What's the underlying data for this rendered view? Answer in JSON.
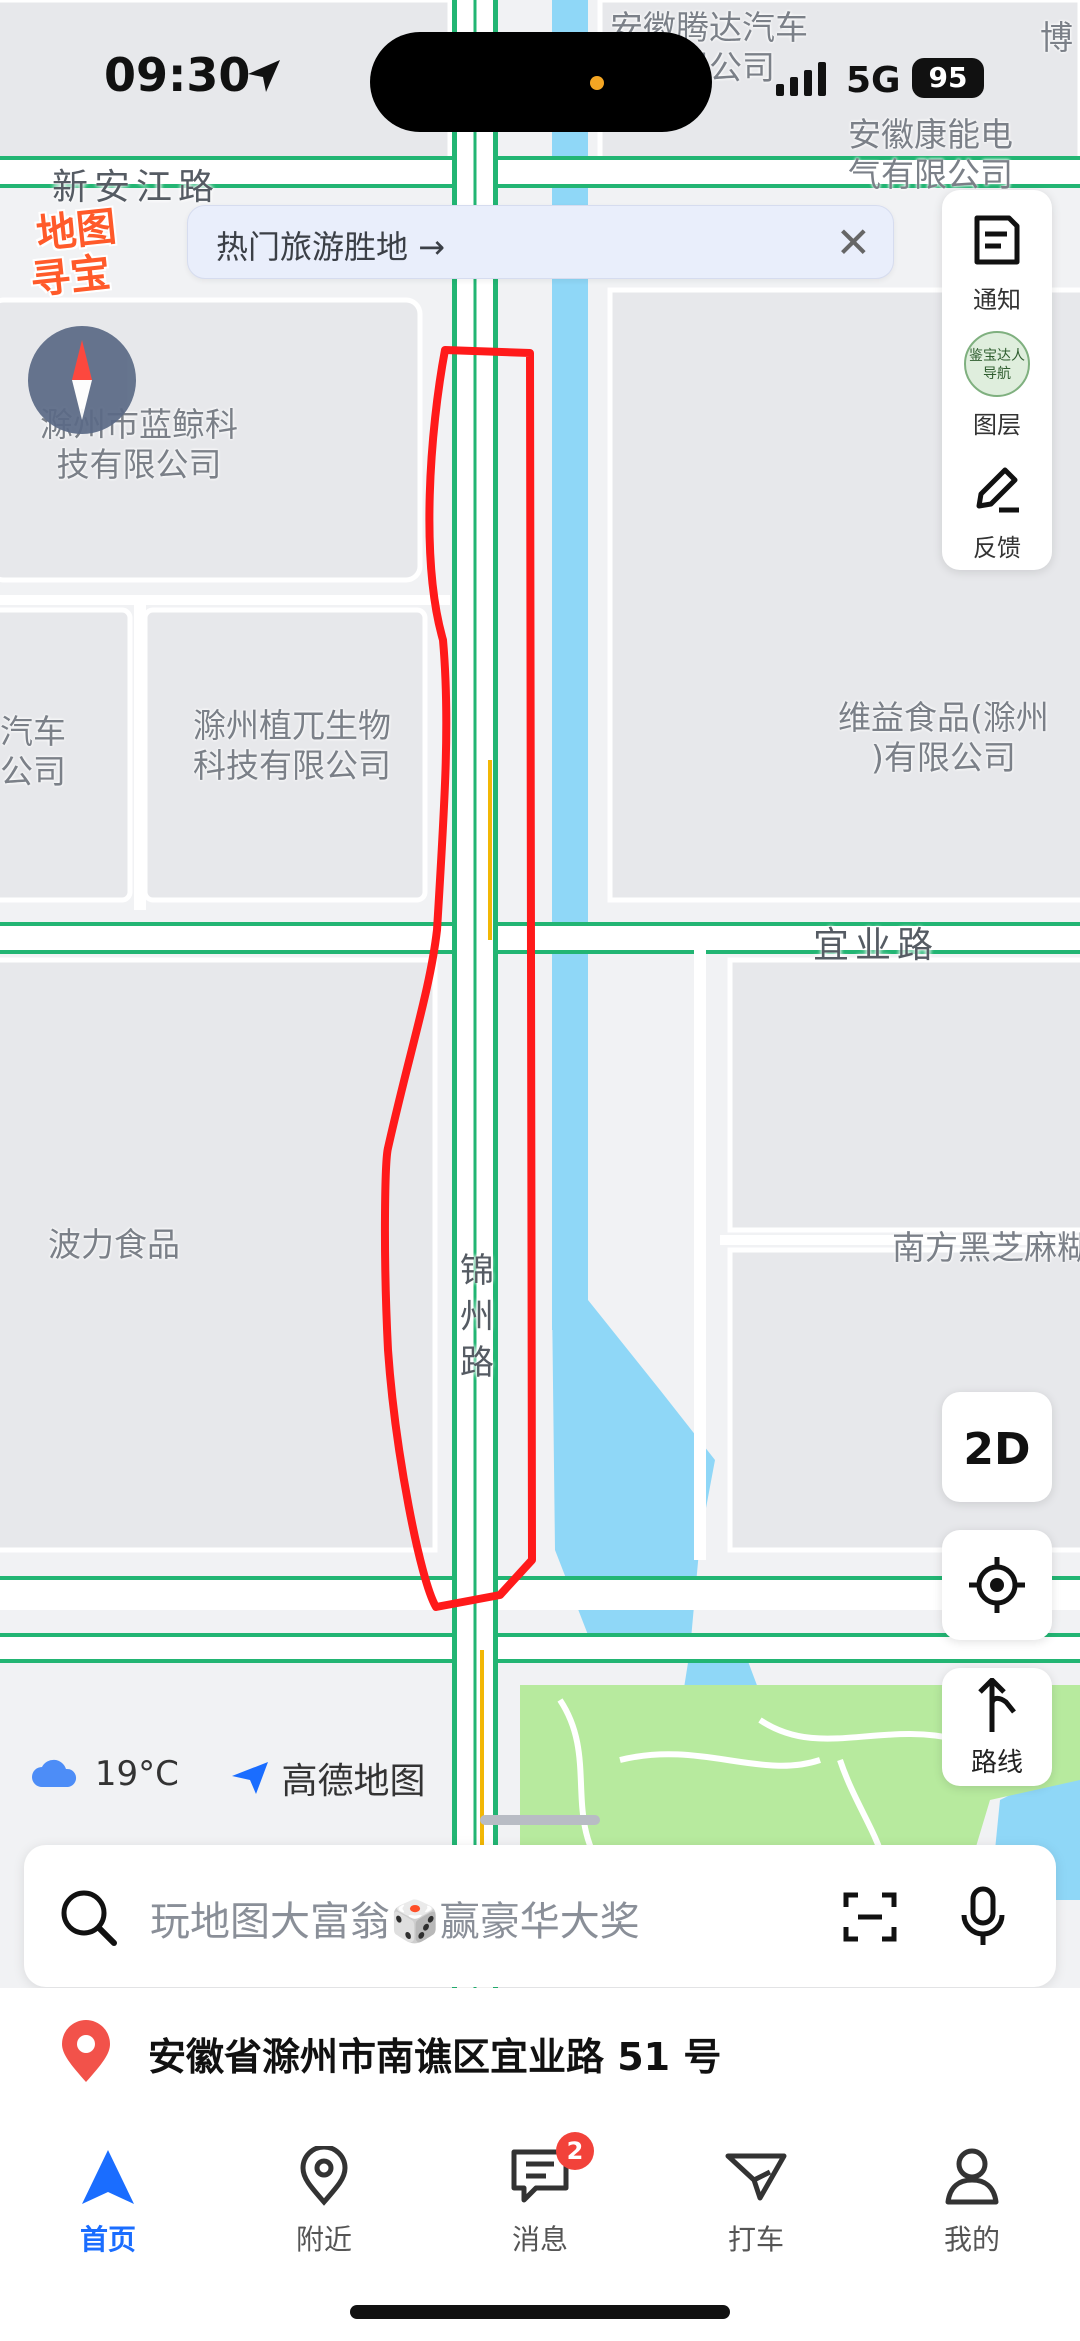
{
  "status_bar": {
    "time": "09:30",
    "network": "5G",
    "battery": "95"
  },
  "map": {
    "labels": {
      "tengda": "安徽腾达汽车\n有限公司",
      "kangneng": "安徽康能电\n气有限公司",
      "bo": "博",
      "lanjing": "滁州市蓝鲸科\n技有限公司",
      "qiche": "汽车\n公司",
      "zhiwu": "滁州植兀生物\n科技有限公司",
      "weiyi": "维益食品(滁州\n)有限公司",
      "boli": "波力食品",
      "nanfang": "南方黑芝麻糊"
    },
    "roads": {
      "xinanjiang": "新安江路",
      "yiye": "宜业路",
      "jinzhou": "锦\n州\n路"
    }
  },
  "banner": {
    "text": "热门旅游胜地 →",
    "close": "✕"
  },
  "logo": {
    "line1": "地图",
    "line2": "寻宝"
  },
  "side_panel": {
    "notify": "通知",
    "layers": "图层",
    "layers_badge": "鉴宝达人\n导航",
    "feedback": "反馈"
  },
  "controls": {
    "mode_2d": "2D",
    "route": "路线"
  },
  "weather": {
    "temp": "19°C"
  },
  "brand": {
    "name": "高德地图"
  },
  "search": {
    "placeholder": "玩地图大富翁🎲赢豪华大奖"
  },
  "address": {
    "text": "安徽省滁州市南谯区宜业路 51 号"
  },
  "tabs": [
    {
      "label": "首页"
    },
    {
      "label": "附近"
    },
    {
      "label": "消息",
      "badge": "2"
    },
    {
      "label": "打车"
    },
    {
      "label": "我的"
    }
  ],
  "colors": {
    "accent": "#1a6dff",
    "road_outline": "#22b573",
    "water": "#8fd7f7",
    "park": "#b7ea9e",
    "highlight": "#ff1a1a"
  }
}
